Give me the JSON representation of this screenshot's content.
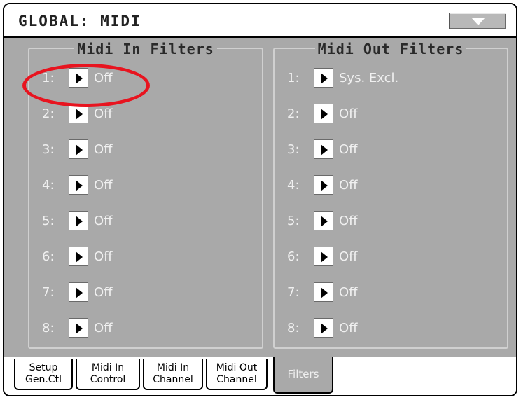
{
  "window": {
    "title": "GLOBAL: MIDI"
  },
  "in_filters": {
    "legend": "Midi In Filters",
    "rows": [
      {
        "num": "1:",
        "value": "Off"
      },
      {
        "num": "2:",
        "value": "Off"
      },
      {
        "num": "3:",
        "value": "Off"
      },
      {
        "num": "4:",
        "value": "Off"
      },
      {
        "num": "5:",
        "value": "Off"
      },
      {
        "num": "6:",
        "value": "Off"
      },
      {
        "num": "7:",
        "value": "Off"
      },
      {
        "num": "8:",
        "value": "Off"
      }
    ]
  },
  "out_filters": {
    "legend": "Midi Out Filters",
    "rows": [
      {
        "num": "1:",
        "value": "Sys. Excl."
      },
      {
        "num": "2:",
        "value": "Off"
      },
      {
        "num": "3:",
        "value": "Off"
      },
      {
        "num": "4:",
        "value": "Off"
      },
      {
        "num": "5:",
        "value": "Off"
      },
      {
        "num": "6:",
        "value": "Off"
      },
      {
        "num": "7:",
        "value": "Off"
      },
      {
        "num": "8:",
        "value": "Off"
      }
    ]
  },
  "tabs": [
    {
      "line1": "Setup",
      "line2": "Gen.Ctl"
    },
    {
      "line1": "Midi In",
      "line2": "Control"
    },
    {
      "line1": "Midi In",
      "line2": "Channel"
    },
    {
      "line1": "Midi Out",
      "line2": "Channel"
    },
    {
      "line1": "Filters",
      "line2": ""
    }
  ],
  "colors": {
    "highlight": "#e8141f",
    "panel_bg": "#a9a9a9"
  }
}
